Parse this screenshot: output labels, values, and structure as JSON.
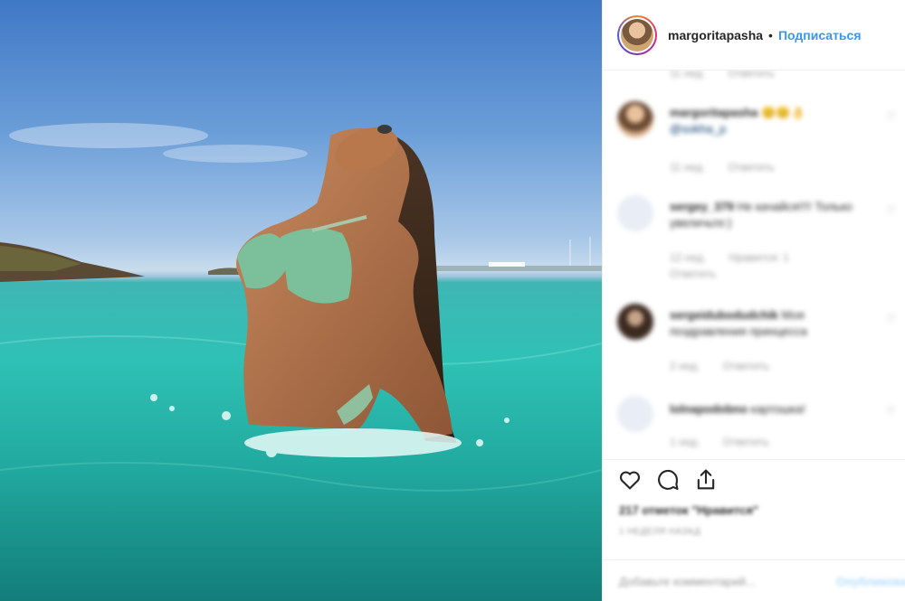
{
  "post": {
    "username": "margoritapasha",
    "separator": "•",
    "follow_label": "Подписаться"
  },
  "comments": [
    {
      "user": "",
      "text": "",
      "time": "11 нед.",
      "like_label": "Ответить"
    },
    {
      "user": "margoritapasha",
      "text": "😊😊👌",
      "mention": "@sokha_p",
      "time": "11 нед.",
      "like_label": "Ответить"
    },
    {
      "user": "sergey_379",
      "text": "Не качайся!!!! Только увеличьте:)",
      "time": "12 нед.",
      "likes": "Нравится: 1",
      "like_label": "Ответить"
    },
    {
      "user": "sergeidubodudchik",
      "text": "Моя поздравления принцесса",
      "time": "2 нед.",
      "like_label": "Ответить"
    },
    {
      "user": "lolnapodobno",
      "text": "картошка!",
      "time": "1 нед.",
      "like_label": "Ответить"
    }
  ],
  "actions": {
    "likes_text": "217 отметок \"Нравится\"",
    "date_text": "1 НЕДЕЛЯ НАЗАД",
    "add_comment_placeholder": "Добавьте комментарий...",
    "publish_label": "Опубликовать"
  },
  "icons": {
    "like": "heart-icon",
    "comment": "speech-bubble-icon",
    "share": "share-icon"
  },
  "colors": {
    "link": "#3897f0",
    "text": "#262626",
    "muted": "#999999",
    "border": "#efefef"
  }
}
